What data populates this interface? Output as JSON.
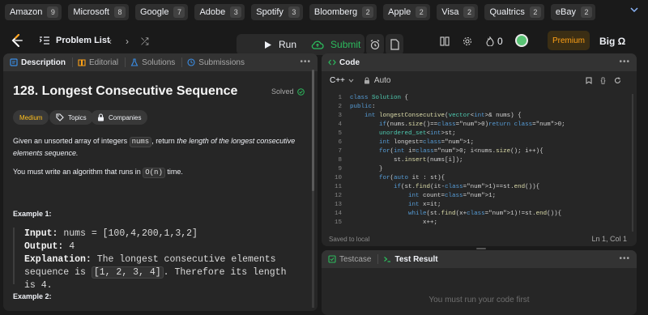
{
  "companies": [
    {
      "name": "Amazon",
      "count": "9"
    },
    {
      "name": "Microsoft",
      "count": "8"
    },
    {
      "name": "Google",
      "count": "7"
    },
    {
      "name": "Adobe",
      "count": "3"
    },
    {
      "name": "Spotify",
      "count": "3"
    },
    {
      "name": "Bloomberg",
      "count": "2"
    },
    {
      "name": "Apple",
      "count": "2"
    },
    {
      "name": "Visa",
      "count": "2"
    },
    {
      "name": "Qualtrics",
      "count": "2"
    },
    {
      "name": "eBay",
      "count": "2"
    }
  ],
  "nav": {
    "problem_list": "Problem List",
    "prev": "‹",
    "next": "›",
    "shuffle": "⤮",
    "run": "Run",
    "submit": "Submit",
    "streak": "0",
    "premium": "Premium",
    "username": "Big Ω"
  },
  "left_tabs": [
    "Description",
    "Editorial",
    "Solutions",
    "Submissions"
  ],
  "problem": {
    "title": "128. Longest Consecutive Sequence",
    "status": "Solved",
    "difficulty": "Medium",
    "topics": "Topics",
    "companies_label": "Companies",
    "desc_pre": "Given an unsorted array of integers ",
    "desc_code": "nums",
    "desc_mid": ", return ",
    "desc_italic1": "the length of the longest consecutive",
    "desc_italic2": "elements sequence.",
    "req_pre": "You must write an algorithm that runs in ",
    "req_code": "O(n)",
    "req_post": " time.",
    "example1_title": "Example 1:",
    "example1_input_label": "Input:",
    "example1_input": " nums = [100,4,200,1,3,2]",
    "example1_output_label": "Output:",
    "example1_output": " 4",
    "example1_expl_label": "Explanation:",
    "example1_expl1": " The longest consecutive elements",
    "example1_expl2_pre": "sequence is ",
    "example1_expl2_code": "[1, 2, 3, 4]",
    "example1_expl2_post": ". Therefore its length is 4.",
    "example2_title": "Example 2:"
  },
  "code_panel": {
    "title": "Code",
    "language": "C++",
    "mode": "Auto",
    "saved": "Saved to local",
    "cursor": "Ln 1, Col 1",
    "line_numbers": [
      "1",
      "2",
      "3",
      "4",
      "5",
      "6",
      "7",
      "8",
      "9",
      "10",
      "11",
      "12",
      "13",
      "14",
      "15"
    ],
    "lines": [
      "class Solution {",
      "public:",
      "    int longestConsecutive(vector<int>& nums) {",
      "        if(nums.size()==0)return 0;",
      "        unordered_set<int>st;",
      "        int longest=1;",
      "        for(int i=0; i<nums.size(); i++){",
      "            st.insert(nums[i]);",
      "        }",
      "        for(auto it : st){",
      "            if(st.find(it-1)==st.end()){",
      "                int count=1;",
      "                int x=it;",
      "                while(st.find(x+1)!=st.end()){",
      "                    x++;"
    ]
  },
  "test_panel": {
    "tab1": "Testcase",
    "tab2": "Test Result",
    "message": "You must run your code first"
  }
}
